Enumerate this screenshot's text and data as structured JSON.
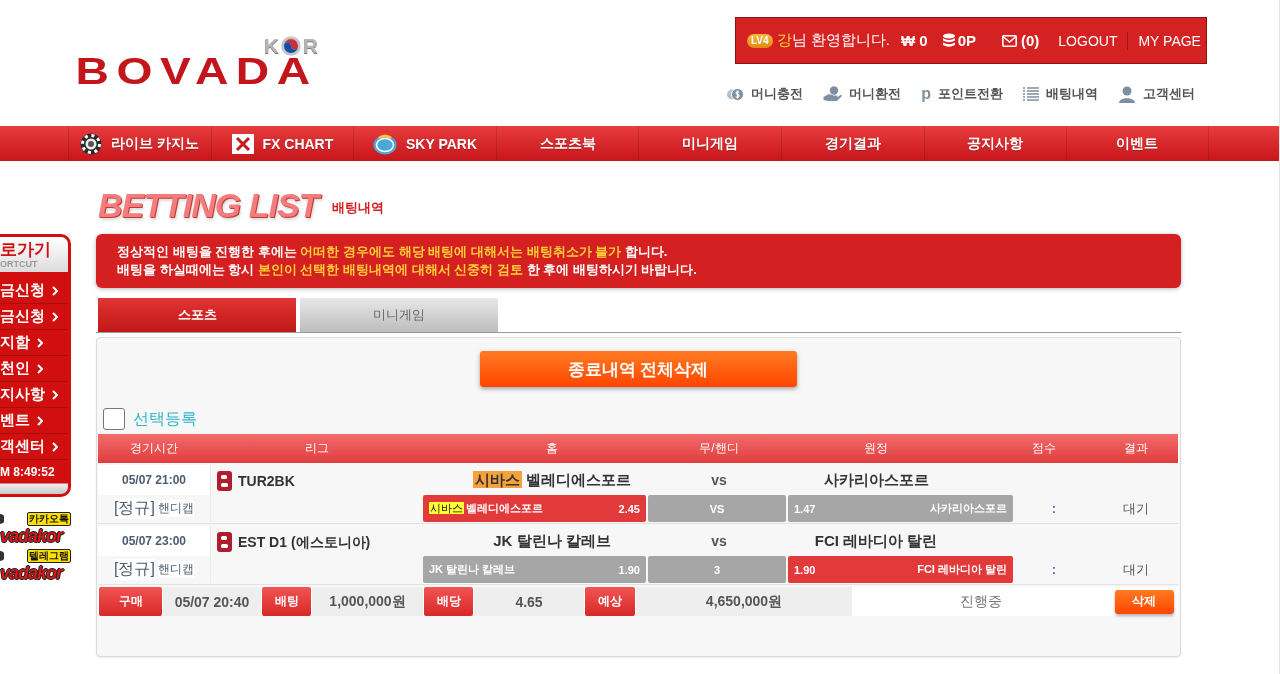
{
  "header": {
    "logo": {
      "badge": [
        "K",
        "R"
      ],
      "wordmark": "BOVADA"
    },
    "user_bar": {
      "level": "LV4",
      "username": "강",
      "greeting": "님 환영합니다.",
      "money": "₩ 0",
      "points": "0P",
      "messages": "(0)",
      "links": [
        "LOGOUT",
        "MY PAGE"
      ]
    },
    "quick_links": [
      {
        "kind": "coins",
        "label": "머니충전"
      },
      {
        "kind": "exchange",
        "label": "머니환전"
      },
      {
        "kind": "point",
        "glyph": "p",
        "label": "포인트전환"
      },
      {
        "kind": "list",
        "label": "배팅내역"
      },
      {
        "kind": "person",
        "label": "고객센터"
      }
    ]
  },
  "nav": [
    {
      "kind": "chip",
      "label": "라이브 카지노"
    },
    {
      "kind": "fx",
      "label": "FX CHART"
    },
    {
      "kind": "sky",
      "label": "SKY PARK"
    },
    {
      "kind": "plain",
      "label": "스포츠북"
    },
    {
      "kind": "plain",
      "label": "미니게임"
    },
    {
      "kind": "plain",
      "label": "경기결과"
    },
    {
      "kind": "plain",
      "label": "공지사항"
    },
    {
      "kind": "plain",
      "label": "이벤트"
    }
  ],
  "quick_menu": {
    "title": "로가기",
    "subtitle": "ORTCUT",
    "items": [
      "금신청",
      "금신청",
      "지함",
      "천인",
      "지사항",
      "벤트",
      "객센터"
    ],
    "clock": "M 8:49:52",
    "contacts": [
      {
        "badge": "카카오톡",
        "handle": "vadakor"
      },
      {
        "badge": "텔레그램",
        "handle": "vadakor"
      }
    ]
  },
  "page": {
    "title": "BETTING LIST",
    "subtitle": "배팅내역"
  },
  "notice": {
    "lines": [
      [
        {
          "text": "정상적인 배팅을 진행한 후에는 ",
          "highlight": false
        },
        {
          "text": "어떠한 경우에도 해당 배팅에 대해서는 배팅취소가 불가",
          "highlight": true
        },
        {
          "text": " 합니다.",
          "highlight": false
        }
      ],
      [
        {
          "text": "배팅을 하실때에는 항시 ",
          "highlight": false
        },
        {
          "text": "본인이 선택한 배팅내역에 대해서 신중히 검토",
          "highlight": true
        },
        {
          "text": " 한 후에 배팅하시기 바랍니다.",
          "highlight": false
        }
      ]
    ]
  },
  "tabs": [
    {
      "label": "스포츠",
      "selected": true
    },
    {
      "label": "미니게임",
      "selected": false
    }
  ],
  "delete_all_button": "종료내역 전체삭제",
  "select": {
    "label": "선택등록",
    "checked": false
  },
  "table": {
    "columns": [
      "경기시간",
      "리그",
      "홈",
      "무/핸디",
      "원정",
      "점수",
      "결과"
    ]
  },
  "bets": [
    {
      "time": "05/07 21:00",
      "type_tag": "[정규]",
      "market": "핸디캡",
      "league": "TUR2BK",
      "home": {
        "tag": "시바스",
        "name": "벨레디에스포르"
      },
      "versus": "vs",
      "away": "사카리아스포르",
      "picks": [
        {
          "kind": "home",
          "tag": "시바스",
          "label": "벨레디에스포르",
          "odds": "2.45",
          "selected": true
        },
        {
          "kind": "draw",
          "label": "VS",
          "selected": false
        },
        {
          "kind": "away",
          "odds": "1.47",
          "label": "사카리아스포르",
          "selected": false
        }
      ],
      "score": ":",
      "result": "대기"
    },
    {
      "time": "05/07 23:00",
      "type_tag": "[정규]",
      "market": "핸디캡",
      "league": "EST D1 (에스토니아)",
      "home": {
        "name": "JK 탈린나 칼레브"
      },
      "versus": "vs",
      "away": "FCI 레바디아 탈린",
      "picks": [
        {
          "kind": "home",
          "label": "JK 탈린나 칼레브",
          "odds": "1.90",
          "selected": false
        },
        {
          "kind": "draw",
          "label": "3",
          "selected": false
        },
        {
          "kind": "away",
          "odds": "1.90",
          "label": "FCI 레바디아 탈린",
          "selected": true
        }
      ],
      "score": ":",
      "result": "대기"
    }
  ],
  "summary": {
    "items": [
      {
        "label": "구매",
        "value": "05/07 20:40"
      },
      {
        "label": "배팅",
        "value": "1,000,000원"
      },
      {
        "label": "배당",
        "value": "4.65"
      },
      {
        "label": "예상",
        "value": "4,650,000원"
      }
    ],
    "status": "진행중",
    "delete_button": "삭제"
  }
}
